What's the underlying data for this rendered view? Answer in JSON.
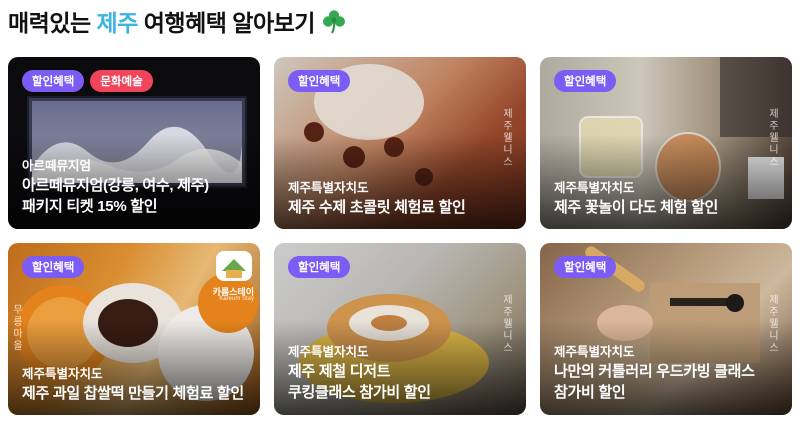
{
  "header": {
    "title_prefix": "매력있는 ",
    "title_accent": "제주",
    "title_suffix": " 여행혜택 알아보기",
    "accent_color": "#3bb3e3",
    "emoji_icon": "shamrock-icon"
  },
  "cards": [
    {
      "badges": [
        "할인혜택",
        "문화예술"
      ],
      "region": "아르떼뮤지엄",
      "name_lines": [
        "아르떼뮤지엄(강릉, 여수, 제주)",
        "패키지 티켓 15% 할인"
      ]
    },
    {
      "badges": [
        "할인혜택"
      ],
      "region": "제주특별자치도",
      "name_lines": [
        "제주 수제 초콜릿 체험료 할인"
      ],
      "vertical_text": "제주웰니스"
    },
    {
      "badges": [
        "할인혜택"
      ],
      "region": "제주특별자치도",
      "name_lines": [
        "제주 꽃놀이 다도 체험 할인"
      ],
      "vertical_text": "제주웰니스"
    },
    {
      "badges": [
        "할인혜택"
      ],
      "region": "제주특별자치도",
      "name_lines": [
        "제주 과일 찹쌀떡 만들기 체험료 할인"
      ],
      "vertical_text": "무릉마을",
      "logo_text": "카름스테이",
      "logo_sub": "Kareum Stay"
    },
    {
      "badges": [
        "할인혜택"
      ],
      "region": "제주특별자치도",
      "name_lines": [
        "제주 제철 디저트",
        "쿠킹클래스 참가비 할인"
      ],
      "vertical_text": "제주웰니스"
    },
    {
      "badges": [
        "할인혜택"
      ],
      "region": "제주특별자치도",
      "name_lines": [
        "나만의 커틀러리 우드카빙 클래스",
        "참가비 할인"
      ],
      "vertical_text": "제주웰니스"
    }
  ]
}
